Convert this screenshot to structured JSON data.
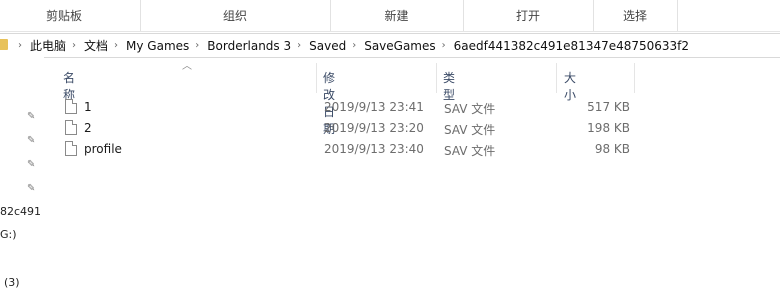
{
  "ribbon": {
    "groups": [
      "剪贴板",
      "组织",
      "新建",
      "打开",
      "选择"
    ]
  },
  "address": {
    "crumbs": [
      "此电脑",
      "文档",
      "My Games",
      "Borderlands 3",
      "Saved",
      "SaveGames",
      "6aedf441382c491e81347e48750633f2"
    ]
  },
  "nav": {
    "items": [
      "82c491",
      "G:)",
      "(3)"
    ]
  },
  "columns": {
    "name": "名称",
    "modified": "修改日期",
    "type": "类型",
    "size": "大小"
  },
  "files": [
    {
      "name": "1",
      "modified": "2019/9/13 23:41",
      "type": "SAV 文件",
      "size": "517 KB",
      "icon": "file-icon"
    },
    {
      "name": "2",
      "modified": "2019/9/13 23:20",
      "type": "SAV 文件",
      "size": "198 KB",
      "icon": "file-icon"
    },
    {
      "name": "profile",
      "modified": "2019/9/13 23:40",
      "type": "SAV 文件",
      "size": "98 KB",
      "icon": "file-icon"
    }
  ]
}
